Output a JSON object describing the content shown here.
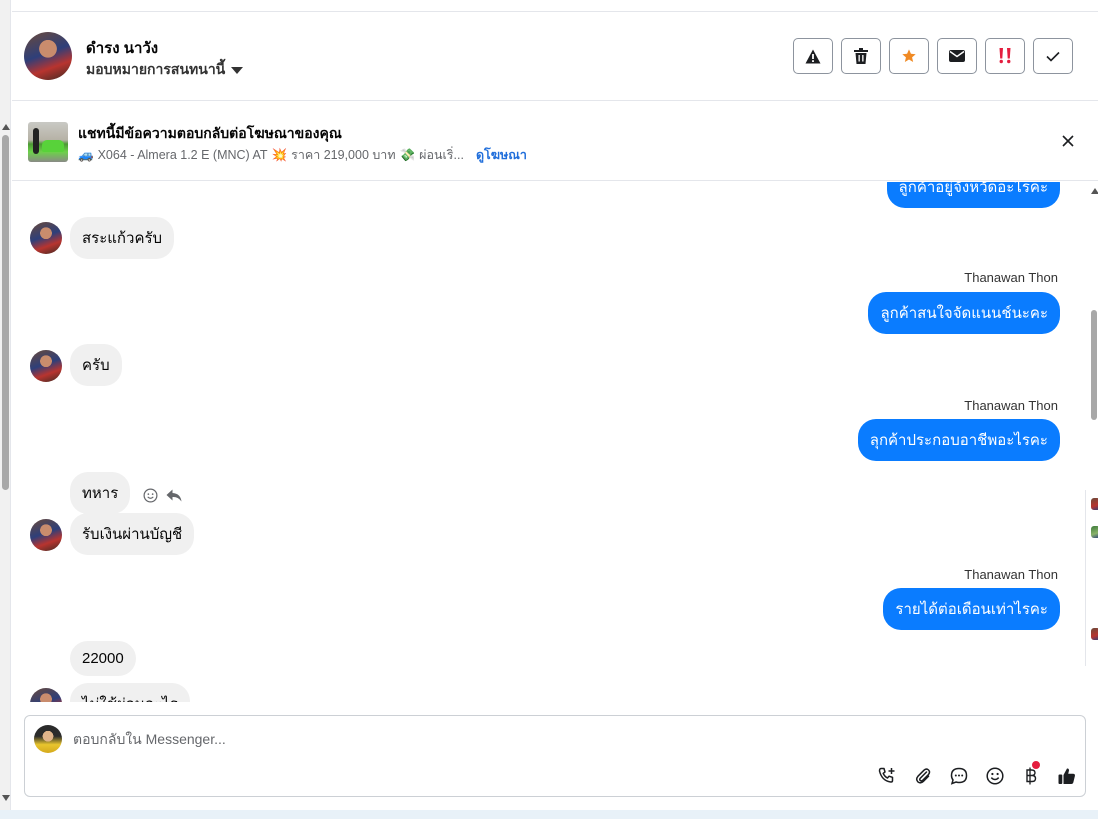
{
  "header": {
    "contact_name": "ดำรง นาวัง",
    "assign_label": "มอบหมายการสนทนานี้",
    "actions": [
      {
        "name": "report-spam",
        "icon": "warning-icon"
      },
      {
        "name": "delete",
        "icon": "trash-icon"
      },
      {
        "name": "star",
        "icon": "star-icon",
        "color": "#f08a24"
      },
      {
        "name": "mark-unread",
        "icon": "envelope-icon"
      },
      {
        "name": "follow-up",
        "icon": "double-exclamation-icon",
        "color": "#e41e3f"
      },
      {
        "name": "mark-done",
        "icon": "check-icon"
      }
    ]
  },
  "ad_banner": {
    "title": "แชทนี้มีข้อความตอบกลับต่อโฆษณาของคุณ",
    "desc_vehicle_emoji": "🚙",
    "desc_model": "X064 - Almera 1.2 E (MNC) AT",
    "desc_burst_emoji": "💥",
    "desc_price": "ราคา 219,000 บาท",
    "desc_money_emoji": "💸",
    "desc_installment": "ผ่อนเริ่...",
    "view_ad_link": "ดูโฆษณา"
  },
  "messages": {
    "m0_out": "ลูกค้าอยู่จังหวัดอะไรคะ",
    "m1_in": "สระแก้วครับ",
    "m2_sender": "Thanawan Thon",
    "m2_out": "ลูกค้าสนใจจัดแนนช์นะคะ",
    "m3_in": "ครับ",
    "m4_sender": "Thanawan Thon",
    "m4_out": "ลุกค้าประกอบอาชีพอะไรคะ",
    "m5_in": "ทหาร",
    "m6_in": "รับเงินผ่านบัญชี",
    "m7_sender": "Thanawan Thon",
    "m7_out": "รายได้ต่อเดือนเท่าไรคะ",
    "m8_in": "22000",
    "m9_in": "ไม่ใช้ผ่อนอะไร"
  },
  "composer": {
    "placeholder": "ตอบกลับใน Messenger...",
    "tools": [
      "phone-plus-icon",
      "paperclip-icon",
      "chat-bubble-icon",
      "smiley-icon",
      "baht-icon",
      "thumbs-up-icon"
    ],
    "notification_color": "#e41e3f"
  }
}
